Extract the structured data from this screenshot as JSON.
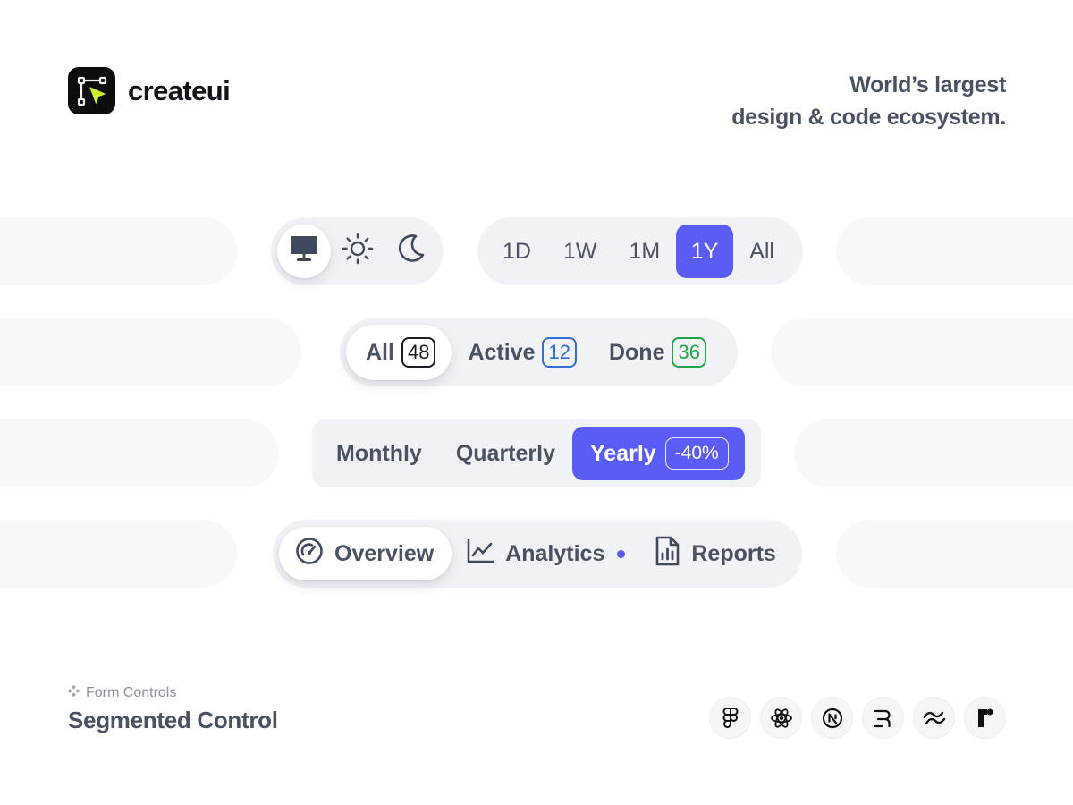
{
  "brand": {
    "name": "createui"
  },
  "tagline": {
    "line1": "World’s largest",
    "line2": "design & code ecosystem."
  },
  "theme_switch": {
    "options": [
      {
        "icon": "monitor-icon",
        "selected": true
      },
      {
        "icon": "sun-icon",
        "selected": false
      },
      {
        "icon": "moon-icon",
        "selected": false
      }
    ]
  },
  "range_switch": {
    "options": [
      "1D",
      "1W",
      "1M",
      "1Y",
      "All"
    ],
    "selected": "1Y"
  },
  "filter_switch": {
    "options": [
      {
        "label": "All",
        "count": "48",
        "color": "#1a1d24",
        "selected": true
      },
      {
        "label": "Active",
        "count": "12",
        "color": "#2f6fd6",
        "selected": false
      },
      {
        "label": "Done",
        "count": "36",
        "color": "#21a34a",
        "selected": false
      }
    ]
  },
  "billing_switch": {
    "options": [
      {
        "label": "Monthly",
        "selected": false
      },
      {
        "label": "Quarterly",
        "selected": false
      },
      {
        "label": "Yearly",
        "badge": "-40%",
        "selected": true
      }
    ]
  },
  "tabs_switch": {
    "options": [
      {
        "label": "Overview",
        "icon": "gauge-icon",
        "selected": true
      },
      {
        "label": "Analytics",
        "icon": "line-chart-icon",
        "has_dot": true,
        "selected": false
      },
      {
        "label": "Reports",
        "icon": "report-icon",
        "selected": false
      }
    ]
  },
  "footer": {
    "category": "Form Controls",
    "title": "Segmented Control",
    "tech_icons": [
      "figma-icon",
      "react-icon",
      "nextjs-icon",
      "remix-icon",
      "tailwind-icon",
      "framer-icon"
    ]
  },
  "colors": {
    "accent": "#5b5cf5",
    "track": "#f1f2f5",
    "text": "#4a5262"
  }
}
